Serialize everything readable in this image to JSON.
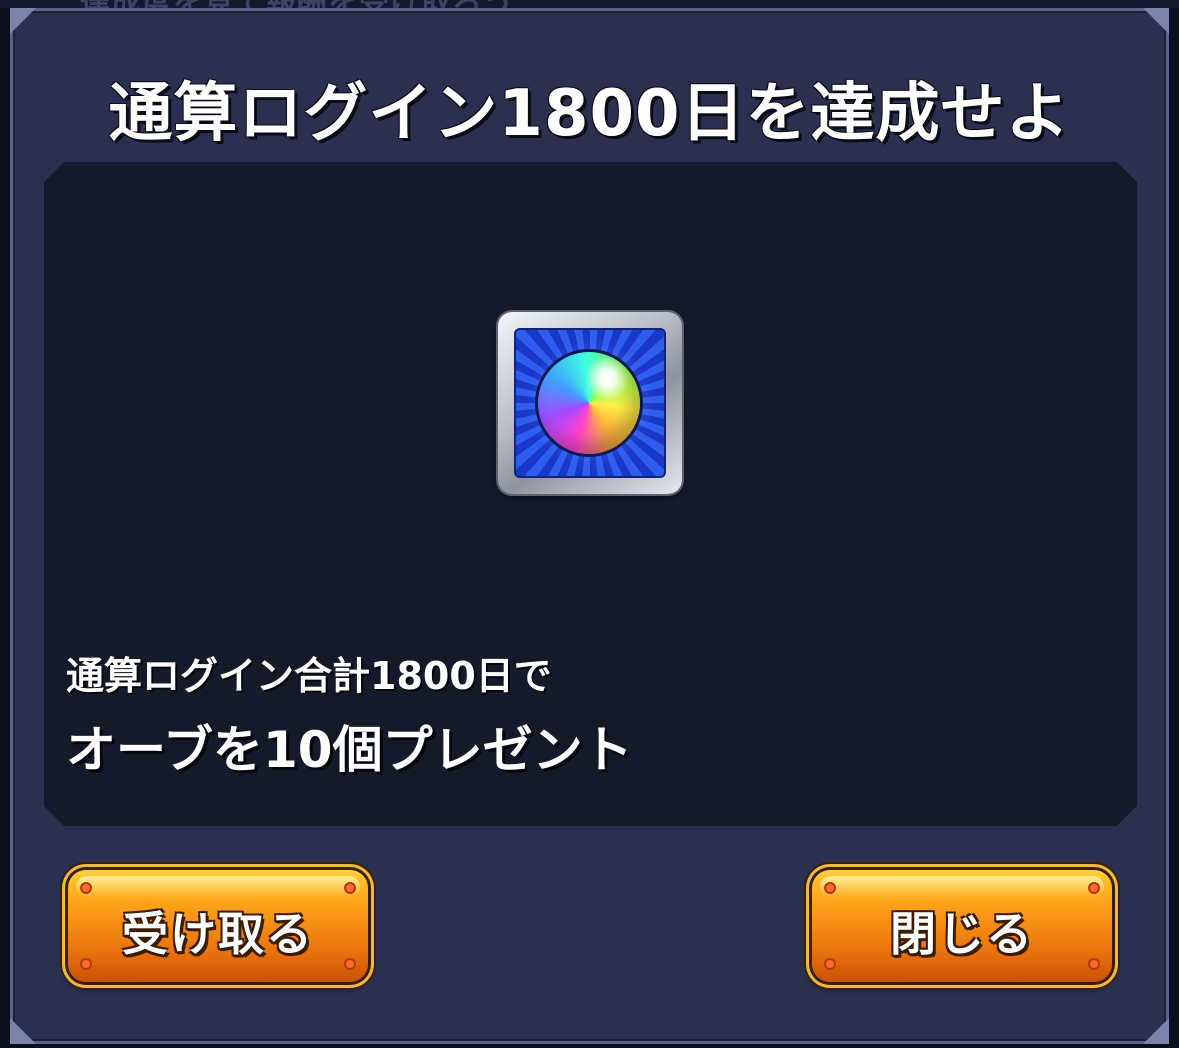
{
  "top_strip": {
    "text": "達成度を見て報酬を受け取ろう"
  },
  "dialog": {
    "title": "通算ログイン1800日を達成せよ",
    "reward": {
      "icon": "rainbow-orb-icon",
      "frame_color": "#c0c3cc",
      "background_color": "#2f5df0"
    },
    "description": {
      "line1": "通算ログイン合計1800日で",
      "line2": "オーブを10個プレゼント"
    },
    "buttons": {
      "receive_label": "受け取る",
      "close_label": "閉じる",
      "color": "#f68c14"
    }
  }
}
